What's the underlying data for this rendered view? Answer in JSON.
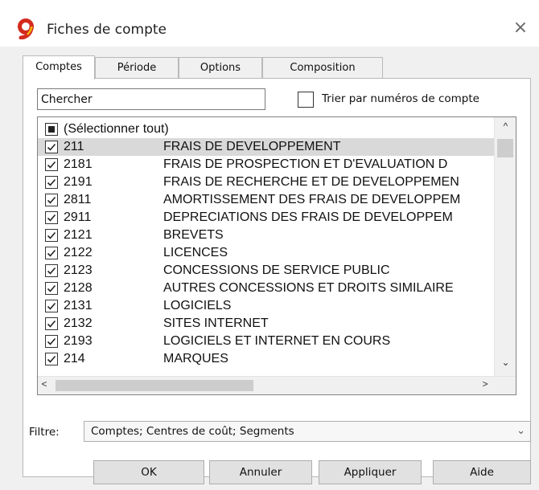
{
  "window": {
    "title": "Fiches de compte",
    "close_symbol": "×"
  },
  "tabs": [
    {
      "label": "Comptes",
      "active": true
    },
    {
      "label": "Période",
      "active": false
    },
    {
      "label": "Options",
      "active": false
    },
    {
      "label": "Composition",
      "active": false
    }
  ],
  "search": {
    "value": "Chercher"
  },
  "sort_option": {
    "label": "Trier par numéros de compte",
    "checked": false
  },
  "list": {
    "select_all_label": "(Sélectionner tout)",
    "rows": [
      {
        "code": "211",
        "name": "FRAIS DE DEVELOPPEMENT",
        "checked": true,
        "selected": true
      },
      {
        "code": "2181",
        "name": "FRAIS DE PROSPECTION ET D'EVALUATION D",
        "checked": true
      },
      {
        "code": "2191",
        "name": "FRAIS DE RECHERCHE ET DE DEVELOPPEMEN",
        "checked": true
      },
      {
        "code": "2811",
        "name": "AMORTISSEMENT DES FRAIS DE DEVELOPPEM",
        "checked": true
      },
      {
        "code": "2911",
        "name": "DEPRECIATIONS DES FRAIS DE DEVELOPPEM",
        "checked": true
      },
      {
        "code": "2121",
        "name": "BREVETS",
        "checked": true
      },
      {
        "code": "2122",
        "name": "LICENCES",
        "checked": true
      },
      {
        "code": "2123",
        "name": "CONCESSIONS DE SERVICE PUBLIC",
        "checked": true
      },
      {
        "code": "2128",
        "name": "AUTRES CONCESSIONS ET DROITS SIMILAIRE",
        "checked": true
      },
      {
        "code": "2131",
        "name": "LOGICIELS",
        "checked": true
      },
      {
        "code": "2132",
        "name": "SITES INTERNET",
        "checked": true
      },
      {
        "code": "2193",
        "name": "LOGICIELS ET INTERNET EN COURS",
        "checked": true
      },
      {
        "code": "214",
        "name": "MARQUES",
        "checked": true
      }
    ],
    "scroll_up": "^",
    "scroll_down": "⌄",
    "scroll_left": "<",
    "scroll_right": ">"
  },
  "filter": {
    "label": "Filtre:",
    "value": "Comptes; Centres de coût; Segments",
    "chevron": "⌄"
  },
  "buttons": {
    "ok": "OK",
    "cancel": "Annuler",
    "apply": "Appliquer",
    "help": "Aide"
  },
  "colors": {
    "logo_red": "#d32b1e",
    "logo_yellow": "#f2b705",
    "selection": "#d9d9d9"
  }
}
